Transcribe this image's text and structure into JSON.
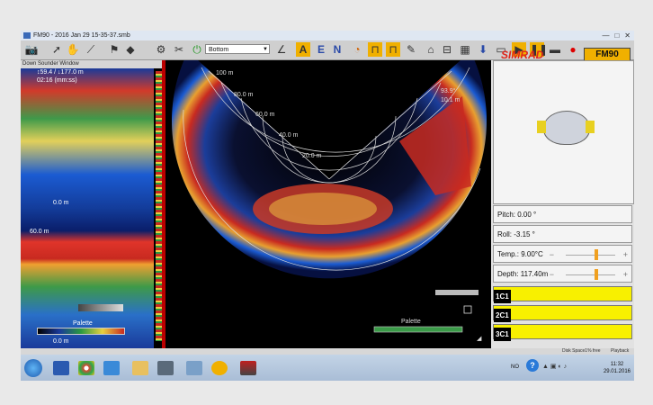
{
  "window": {
    "title": "FM90 - 2016 Jan 29 15-35-37.smb",
    "controls": [
      "—",
      "□",
      "✕"
    ]
  },
  "toolbar": {
    "view_select": "Bottom",
    "letters": [
      "A",
      "E",
      "N"
    ]
  },
  "brand": {
    "logo": "SIMRAD",
    "model": "FM90"
  },
  "downsounder": {
    "caption": "Down Sounder Window",
    "depth_readout": "↕59.4 / ↓177.0 m",
    "time_readout": "02:16 (mm:ss)",
    "labels": [
      "0.0 m",
      "60.0 m",
      "0.0 m"
    ],
    "palette_label": "Palette"
  },
  "sonar": {
    "range_labels": [
      "100 m",
      "80.0 m",
      "60.0 m",
      "40.0 m",
      "20.0 m"
    ],
    "right_labels": [
      "93.9°",
      "10.1 m"
    ],
    "palette_label": "Palette"
  },
  "sensors": {
    "pitch": "Pitch: 0.00 °",
    "roll": "Roll: -3.15 °",
    "temp": "Temp.: 9.00°C",
    "depth": "Depth: 117.40m"
  },
  "channels": [
    "1C1",
    "2C1",
    "3C1"
  ],
  "status": {
    "disk": "Disk Space1% free",
    "mode": "Playback"
  },
  "taskbar": {
    "lang": "NO",
    "time": "11:32",
    "date": "29.01.2016"
  },
  "colors": {
    "accent": "#f8f000",
    "brand": "#e0261b",
    "model_bg": "#f0b000"
  }
}
